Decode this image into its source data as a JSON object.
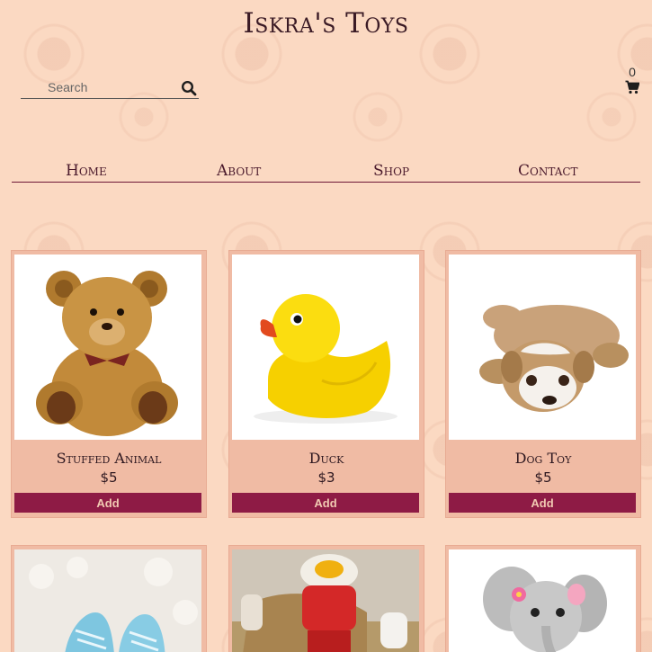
{
  "header": {
    "title": "Iskra's Toys"
  },
  "search": {
    "placeholder": "Search",
    "icon": "search-icon"
  },
  "cart": {
    "count": "0",
    "icon": "cart-icon"
  },
  "nav": {
    "items": [
      {
        "label": "Home"
      },
      {
        "label": "About"
      },
      {
        "label": "Shop"
      },
      {
        "label": "Contact"
      }
    ]
  },
  "products": [
    {
      "name": "Stuffed Animal",
      "price": "$5",
      "button": "Add",
      "image": "teddy-bear"
    },
    {
      "name": "Duck",
      "price": "$3",
      "button": "Add",
      "image": "rubber-duck"
    },
    {
      "name": "Dog Toy",
      "price": "$5",
      "button": "Add",
      "image": "plush-dog"
    },
    {
      "image": "baby-shoes"
    },
    {
      "image": "wooden-toys"
    },
    {
      "image": "plush-elephant"
    }
  ],
  "colors": {
    "background": "#fbd9c2",
    "card": "#f0bba4",
    "button": "#8e1b45",
    "button_text": "#f1c9b2",
    "title": "#3a1a25"
  }
}
